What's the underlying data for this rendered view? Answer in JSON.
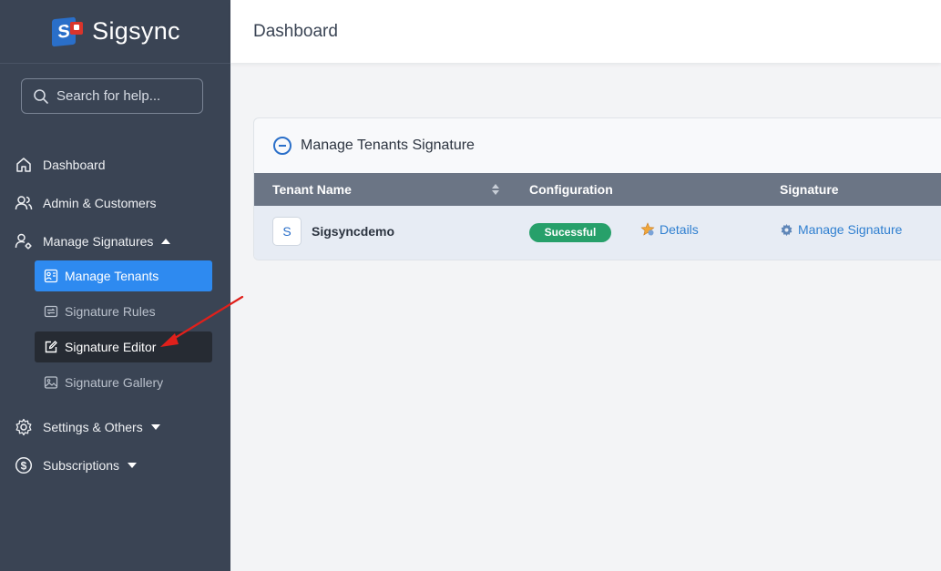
{
  "app": {
    "name": "Sigsync"
  },
  "sidebar": {
    "search_placeholder": "Search for help...",
    "items": [
      {
        "label": "Dashboard",
        "icon": "home-icon"
      },
      {
        "label": "Admin & Customers",
        "icon": "users-icon"
      },
      {
        "label": "Manage Signatures",
        "icon": "user-gear-icon",
        "expanded": true
      },
      {
        "label": "Settings & Others",
        "icon": "gear-icon"
      },
      {
        "label": "Subscriptions",
        "icon": "dollar-circle-icon"
      }
    ],
    "sub_items": [
      {
        "label": "Manage Tenants",
        "icon": "tenants-icon",
        "state": "active"
      },
      {
        "label": "Signature Rules",
        "icon": "rules-icon"
      },
      {
        "label": "Signature Editor",
        "icon": "edit-icon",
        "state": "highlighted"
      },
      {
        "label": "Signature Gallery",
        "icon": "gallery-icon"
      }
    ]
  },
  "header": {
    "title": "Dashboard"
  },
  "card": {
    "title": "Manage Tenants Signature",
    "columns": [
      "Tenant Name",
      "Configuration",
      "Signature"
    ],
    "rows": [
      {
        "avatar": "S",
        "tenant_name": "Sigsyncdemo",
        "status": "Sucessful",
        "details_label": "Details",
        "signature_label": "Manage Signature"
      }
    ]
  },
  "colors": {
    "sidebar_bg": "#3a4454",
    "accent": "#2e8af0",
    "success": "#27a06a",
    "link": "#2f7fd0",
    "annotation_arrow": "#e0201b"
  }
}
